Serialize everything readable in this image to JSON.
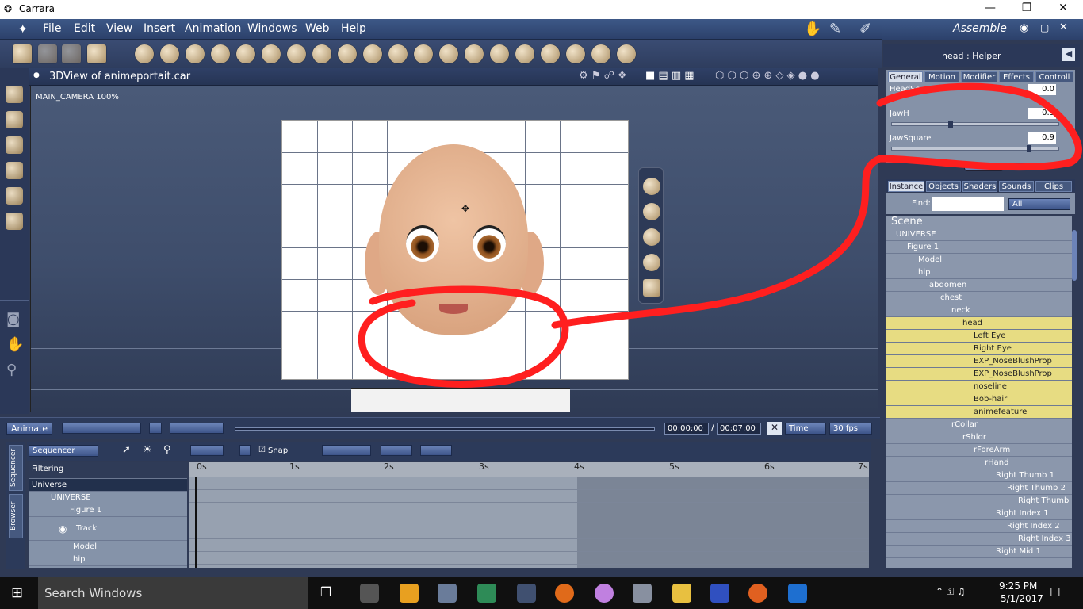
{
  "window": {
    "title": "Carrara",
    "minimize": "—",
    "restore": "❐",
    "close": "✕"
  },
  "menu": [
    "File",
    "Edit",
    "View",
    "Insert",
    "Animation",
    "Windows",
    "Web",
    "Help"
  ],
  "room": {
    "label": "Assemble"
  },
  "viewport": {
    "title": "3DView of animeportait.car",
    "camera": "MAIN_CAMERA 100%"
  },
  "timeline": {
    "animate": "Animate",
    "current_time": "00:00:00",
    "separator": "/",
    "end_time": "00:07:00",
    "time_mode": "Time",
    "fps": "30 fps"
  },
  "sequencer": {
    "mode": "Sequencer",
    "snap": "Snap",
    "filtering": "Filtering",
    "tabs": [
      "Sequencer",
      "Browser"
    ],
    "rows": [
      "Universe",
      "UNIVERSE",
      "Figure 1",
      "Track",
      "Model",
      "hip"
    ],
    "ticks": [
      "0s",
      "1s",
      "2s",
      "3s",
      "4s",
      "5s",
      "6s",
      "7s"
    ]
  },
  "properties": {
    "header": "head : Helper",
    "tabs": [
      "General",
      "Motion",
      "Modifier",
      "Effects",
      "Controll"
    ],
    "fields": [
      {
        "label": "HeadSc",
        "value": "0.0"
      },
      {
        "label": "JawH",
        "value": "0.3",
        "level": 0.35
      },
      {
        "label": "JawSquare",
        "value": "0.9",
        "level": 0.83
      }
    ]
  },
  "scene": {
    "tabs": [
      "Instance",
      "Objects",
      "Shaders",
      "Sounds",
      "Clips"
    ],
    "find_label": "Find:",
    "find_value": "",
    "filter": "All",
    "root": "Scene",
    "nodes": [
      {
        "name": "UNIVERSE",
        "depth": 0,
        "sel": false
      },
      {
        "name": "Figure 1",
        "depth": 1,
        "sel": false
      },
      {
        "name": "Model",
        "depth": 2,
        "sel": false
      },
      {
        "name": "hip",
        "depth": 2,
        "sel": false
      },
      {
        "name": "abdomen",
        "depth": 3,
        "sel": false
      },
      {
        "name": "chest",
        "depth": 4,
        "sel": false
      },
      {
        "name": "neck",
        "depth": 5,
        "sel": false
      },
      {
        "name": "head",
        "depth": 6,
        "sel": true
      },
      {
        "name": "Left Eye",
        "depth": 7,
        "sel": true
      },
      {
        "name": "Right Eye",
        "depth": 7,
        "sel": true
      },
      {
        "name": "EXP_NoseBlushProp",
        "depth": 7,
        "sel": true
      },
      {
        "name": "EXP_NoseBlushProp",
        "depth": 7,
        "sel": true
      },
      {
        "name": "noseline",
        "depth": 7,
        "sel": true
      },
      {
        "name": "Bob-hair",
        "depth": 7,
        "sel": true
      },
      {
        "name": "animefeature",
        "depth": 7,
        "sel": true
      },
      {
        "name": "rCollar",
        "depth": 5,
        "sel": false
      },
      {
        "name": "rShldr",
        "depth": 6,
        "sel": false
      },
      {
        "name": "rForeArm",
        "depth": 7,
        "sel": false
      },
      {
        "name": "rHand",
        "depth": 8,
        "sel": false
      },
      {
        "name": "Right Thumb 1",
        "depth": 9,
        "sel": false
      },
      {
        "name": "Right Thumb 2",
        "depth": 10,
        "sel": false
      },
      {
        "name": "Right Thumb",
        "depth": 11,
        "sel": false
      },
      {
        "name": "Right Index 1",
        "depth": 9,
        "sel": false
      },
      {
        "name": "Right Index 2",
        "depth": 10,
        "sel": false
      },
      {
        "name": "Right Index 3",
        "depth": 11,
        "sel": false
      },
      {
        "name": "Right Mid 1",
        "depth": 9,
        "sel": false
      }
    ]
  },
  "taskbar": {
    "search": "Search Windows",
    "time": "9:25 PM",
    "date": "5/1/2017"
  }
}
